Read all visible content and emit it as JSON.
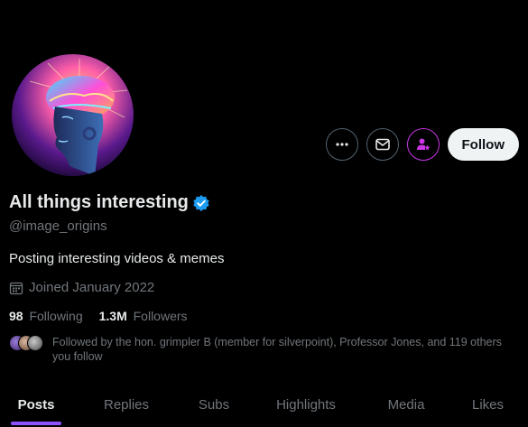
{
  "profile": {
    "display_name": "All things interesting",
    "handle": "@image_origins",
    "bio": "Posting interesting videos & memes",
    "joined": "Joined January 2022",
    "verified_icon": "verified-badge-icon"
  },
  "actions": {
    "more_icon": "more-icon",
    "message_icon": "mail-icon",
    "subscribe_icon": "subscribe-icon",
    "follow_label": "Follow"
  },
  "stats": {
    "following_count": "98",
    "following_label": "Following",
    "followers_count": "1.3M",
    "followers_label": "Followers"
  },
  "followed_by": {
    "text": "Followed by the hon. grimpler B (member for silverpoint), Professor Jones, and 119 others you follow"
  },
  "tabs": [
    {
      "label": "Posts",
      "active": true
    },
    {
      "label": "Replies",
      "active": false
    },
    {
      "label": "Subs",
      "active": false
    },
    {
      "label": "Highlights",
      "active": false
    },
    {
      "label": "Media",
      "active": false
    },
    {
      "label": "Likes",
      "active": false
    }
  ],
  "colors": {
    "background": "#000000",
    "text_primary": "#e7e9ea",
    "text_secondary": "#71767b",
    "verified_blue": "#1d9bf0",
    "subscribe_purple": "#c936e4",
    "tab_indicator": "#8c52ff",
    "follow_button_bg": "#eff3f4"
  }
}
